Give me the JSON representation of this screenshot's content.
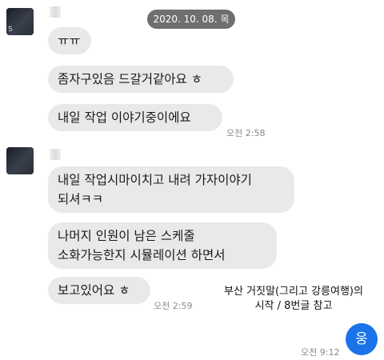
{
  "date_separator": "2020. 10. 08. 목",
  "groups": [
    {
      "messages": [
        "ㅠㅠ",
        "좀자구있음 드갈거같아요 ㅎ",
        "내일 작업 이야기중이에요"
      ],
      "time": "오전 2:58"
    },
    {
      "messages": [
        "내일 작업시마이치고 내려 가자이야기\n되셔ㅋㅋ",
        "나머지 인원이 남은 스케줄\n소화가능한지 시뮬레이션 하면서",
        "보고있어요 ㅎ"
      ],
      "time": "오전 2:59"
    }
  ],
  "annotation": "부산 거짓말(그리고 강릉여행)의\n시작 / 8번글 참고",
  "self_message": {
    "text": "웅",
    "time": "오전 9:12"
  },
  "colors": {
    "incoming_bubble": "#e9e9ec",
    "outgoing_bubble": "#1a73e8",
    "date_pill": "#6f6f6f"
  }
}
